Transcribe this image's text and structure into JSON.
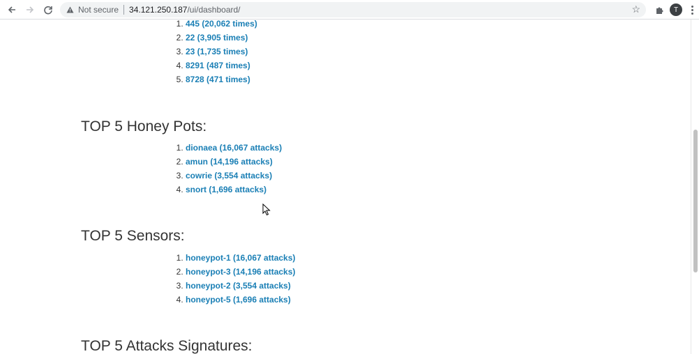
{
  "browser": {
    "security_label": "Not secure",
    "url_host": "34.121.250.187",
    "url_path": "/ui/dashboard/",
    "profile_initial": "T"
  },
  "ports_list": [
    {
      "label": "445 (20,062 times)"
    },
    {
      "label": "22 (3,905 times)"
    },
    {
      "label": "23 (1,735 times)"
    },
    {
      "label": "8291 (487 times)"
    },
    {
      "label": "8728 (471 times)"
    }
  ],
  "honeypots": {
    "title": "TOP 5 Honey Pots:",
    "items": [
      {
        "label": "dionaea (16,067 attacks)"
      },
      {
        "label": "amun (14,196 attacks)"
      },
      {
        "label": "cowrie (3,554 attacks)"
      },
      {
        "label": "snort (1,696 attacks)"
      }
    ]
  },
  "sensors": {
    "title": "TOP 5 Sensors:",
    "items": [
      {
        "label": "honeypot-1 (16,067 attacks)"
      },
      {
        "label": "honeypot-3 (14,196 attacks)"
      },
      {
        "label": "honeypot-2 (3,554 attacks)"
      },
      {
        "label": "honeypot-5 (1,696 attacks)"
      }
    ]
  },
  "signatures": {
    "title": "TOP 5 Attacks Signatures:"
  },
  "colors": {
    "link": "#1a7fb5",
    "heading": "#333333"
  }
}
